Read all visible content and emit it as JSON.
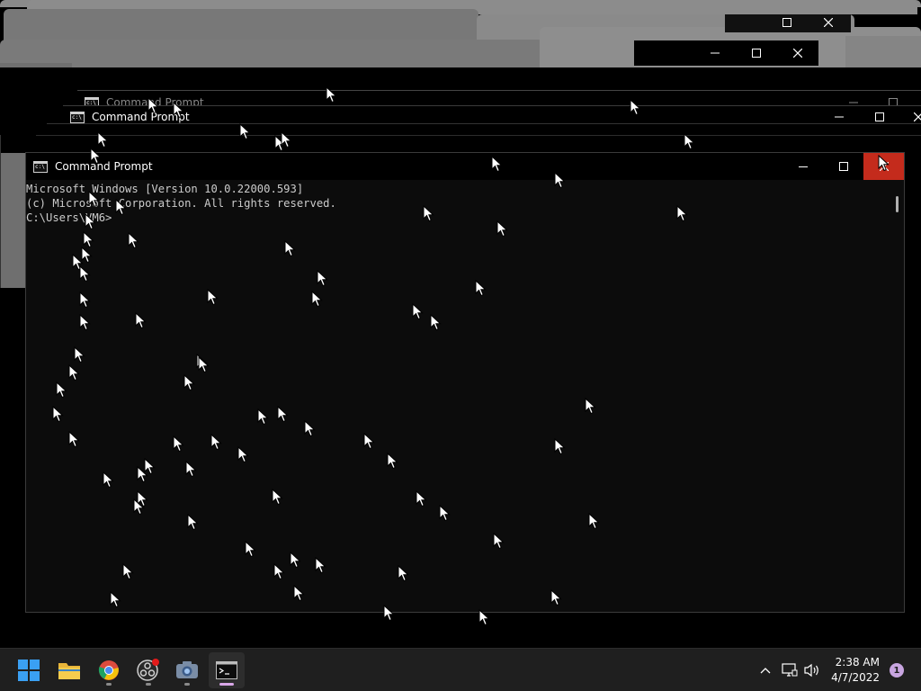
{
  "window": {
    "title": "Command Prompt",
    "console_lines": [
      "Microsoft Windows [Version 10.0.22000.593]",
      "(c) Microsoft Corporation. All rights reserved.",
      "",
      "C:\\Users\\VM6>"
    ]
  },
  "ghost_windows": {
    "title_1": "Command Prompt",
    "title_2": "Command Prompt"
  },
  "colors": {
    "close_button": "#c42b1c",
    "console_bg": "#0c0c0c",
    "console_text": "#cccccc",
    "taskbar_bg": "#1f1f1f"
  },
  "taskbar": {
    "apps": [
      {
        "icon": "windows-start-icon"
      },
      {
        "icon": "file-explorer-icon"
      },
      {
        "icon": "chrome-icon"
      },
      {
        "icon": "obs-studio-icon"
      },
      {
        "icon": "camera-icon"
      },
      {
        "icon": "command-prompt-icon",
        "active": true
      }
    ],
    "tray": {
      "icons": [
        "chevron-up-icon",
        "network-icon",
        "volume-icon"
      ],
      "time": "2:38 AM",
      "date": "4/7/2022",
      "notification_count": "1"
    }
  }
}
